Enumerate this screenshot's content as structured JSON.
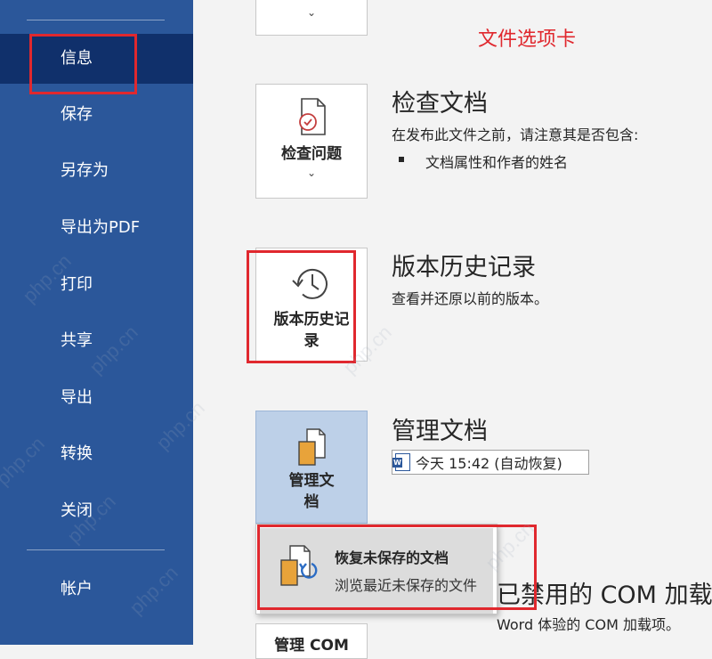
{
  "sidebar": {
    "items": [
      {
        "label": "信息",
        "active": true
      },
      {
        "label": "保存"
      },
      {
        "label": "另存为"
      },
      {
        "label": "导出为PDF"
      },
      {
        "label": "打印"
      },
      {
        "label": "共享"
      },
      {
        "label": "导出"
      },
      {
        "label": "转换"
      },
      {
        "label": "关闭"
      }
    ],
    "account": "帐户"
  },
  "annotation": "文件选项卡",
  "inspect": {
    "tile_label": "检查问题",
    "title": "检查文档",
    "desc": "在发布此文件之前，请注意其是否包含:",
    "bullet": "文档属性和作者的姓名"
  },
  "version_history": {
    "tile_label_line1": "版本历史记",
    "tile_label_line2": "录",
    "title": "版本历史记录",
    "desc": "查看并还原以前的版本。"
  },
  "manage": {
    "tile_label_line1": "管理文",
    "tile_label_line2": "档",
    "title": "管理文档",
    "version_entry": "今天 15:42 (自动恢复)"
  },
  "dropdown": {
    "title": "恢复未保存的文档",
    "desc": "浏览最近未保存的文件"
  },
  "com": {
    "title": "已禁用的 COM 加载",
    "desc": "Word 体验的 COM 加载项。",
    "tile_label": "管理 COM"
  },
  "watermark": "php.cn",
  "colors": {
    "sidebar": "#2b579a",
    "sidebar_active": "#10306b",
    "highlight_red": "#e0282e",
    "tile_pressed": "#bdd0e8"
  }
}
